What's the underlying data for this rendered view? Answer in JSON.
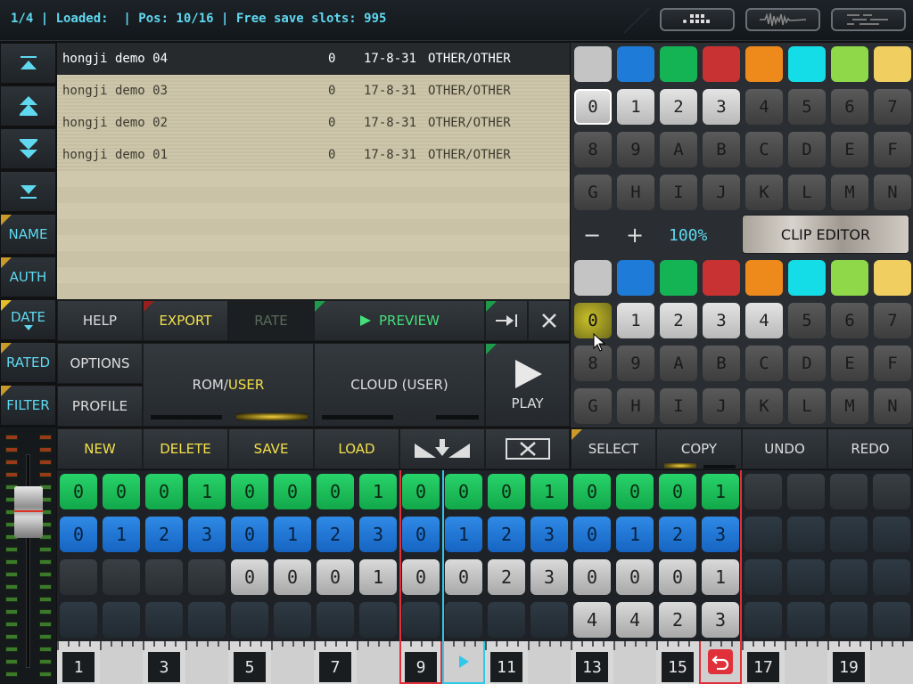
{
  "status": {
    "text": "1/4 | Loaded:  | Pos: 10/16 | Free save slots: 995"
  },
  "top_buttons": [
    "grid-view-icon",
    "waveform-icon",
    "piano-roll-icon"
  ],
  "nav": {
    "buttons": [
      "scroll-top-icon",
      "page-up-icon",
      "page-down-icon",
      "scroll-bottom-icon"
    ],
    "sort": [
      "NAME",
      "AUTH",
      "DATE",
      "RATED",
      "FILTER"
    ]
  },
  "list": {
    "rows": [
      {
        "name": "hongji demo 04",
        "num": "0",
        "date": "17-8-31",
        "cat": "OTHER/OTHER",
        "selected": true
      },
      {
        "name": "hongji demo 03",
        "num": "0",
        "date": "17-8-31",
        "cat": "OTHER/OTHER",
        "selected": false
      },
      {
        "name": "hongji demo 02",
        "num": "0",
        "date": "17-8-31",
        "cat": "OTHER/OTHER",
        "selected": false
      },
      {
        "name": "hongji demo 01",
        "num": "0",
        "date": "17-8-31",
        "cat": "OTHER/OTHER",
        "selected": false
      }
    ]
  },
  "actions": {
    "help": "HELP",
    "export": "EXPORT",
    "rate": "RATE",
    "preview": "PREVIEW",
    "options": "OPTIONS",
    "profile": "PROFILE",
    "rom_user_a": "ROM/",
    "rom_user_b": "USER",
    "cloud": "CLOUD (USER)",
    "play": "PLAY"
  },
  "edit_bar": {
    "new": "NEW",
    "delete": "DELETE",
    "save": "SAVE",
    "load": "LOAD",
    "select": "SELECT",
    "copy": "COPY",
    "undo": "UNDO",
    "redo": "REDO"
  },
  "keypad": {
    "colors": [
      "#c4c4c4",
      "#1e7bd8",
      "#14b455",
      "#c83232",
      "#ee8a1c",
      "#14dde8",
      "#8ed84a",
      "#f0cf60"
    ],
    "rows": [
      [
        "0",
        "1",
        "2",
        "3",
        "4",
        "5",
        "6",
        "7"
      ],
      [
        "8",
        "9",
        "A",
        "B",
        "C",
        "D",
        "E",
        "F"
      ],
      [
        "G",
        "H",
        "I",
        "J",
        "K",
        "L",
        "M",
        "N"
      ]
    ],
    "upper_light_count": 4,
    "lower_light_count": 5
  },
  "zoom": {
    "minus": "−",
    "plus": "+",
    "level": "100%",
    "clip_editor": "CLIP EDITOR"
  },
  "sequencer": {
    "rows": [
      {
        "style": "green",
        "values": [
          "0",
          "0",
          "0",
          "1",
          "0",
          "0",
          "0",
          "1",
          "0",
          "0",
          "0",
          "1",
          "0",
          "0",
          "0",
          "1"
        ]
      },
      {
        "style": "blue",
        "values": [
          "0",
          "1",
          "2",
          "3",
          "0",
          "1",
          "2",
          "3",
          "0",
          "1",
          "2",
          "3",
          "0",
          "1",
          "2",
          "3"
        ]
      },
      {
        "style": "gray",
        "values": [
          "",
          "",
          "",
          "",
          "0",
          "0",
          "0",
          "1",
          "0",
          "0",
          "2",
          "3",
          "0",
          "0",
          "0",
          "1"
        ]
      },
      {
        "style": "gray",
        "values": [
          "",
          "",
          "",
          "",
          "",
          "",
          "",
          "",
          "",
          "",
          "",
          "",
          "4",
          "4",
          "2",
          "3"
        ]
      }
    ],
    "extra_cols": 4
  },
  "ruler": {
    "numbers": [
      "1",
      "3",
      "5",
      "7",
      "9",
      "",
      "11",
      "13",
      "15",
      "",
      "17",
      "19"
    ]
  },
  "colors": {
    "accent_cyan": "#5fd8f0",
    "accent_yellow": "#f2e04a",
    "accent_green": "#44e07a",
    "loop_red": "#e0303a"
  }
}
